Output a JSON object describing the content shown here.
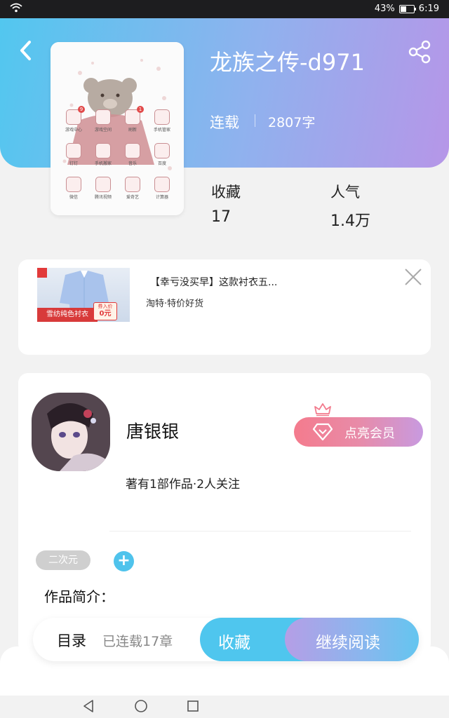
{
  "status_bar": {
    "battery": "43%",
    "battery_level": 0.43,
    "time": "6:19"
  },
  "book": {
    "title": "龙族之传-d971",
    "status": "连载",
    "word_count": "2807字",
    "stats": [
      {
        "label": "收藏",
        "value": "17"
      },
      {
        "label": "人气",
        "value": "1.4万"
      }
    ]
  },
  "cover": {
    "icons": [
      "游戏中心",
      "游戏空间",
      "刷新",
      "手机管家",
      "钉钉",
      "手机搬家",
      "音乐",
      "百度",
      "微信",
      "腾讯视频",
      "爱奇艺",
      "计算器"
    ],
    "badges": [
      "9",
      "1"
    ]
  },
  "ad": {
    "image_text": "雪纺纯色衬衣",
    "price_label": "券入价",
    "price": "0元",
    "title": "【幸亏没买早】这款衬衣五...",
    "subtitle": "淘特·特价好货"
  },
  "author": {
    "name": "唐银银",
    "stats": "著有1部作品·2人关注",
    "vip_button": "点亮会员",
    "tag": "二次元",
    "add_tag": "+",
    "intro_label": "作品简介："
  },
  "action_bar": {
    "toc": "目录",
    "chapters": "已连载17章",
    "favorite": "收藏",
    "continue": "继续阅读"
  },
  "colors": {
    "accent_blue": "#4fc6ee",
    "accent_purple": "#b696e8",
    "vip_pink": "#f47b8d"
  },
  "icons": [
    "back-icon",
    "share-icon",
    "close-icon",
    "diamond-icon",
    "crown-icon",
    "wifi-icon",
    "battery-icon",
    "nav-back-icon",
    "nav-home-icon",
    "nav-recent-icon"
  ]
}
